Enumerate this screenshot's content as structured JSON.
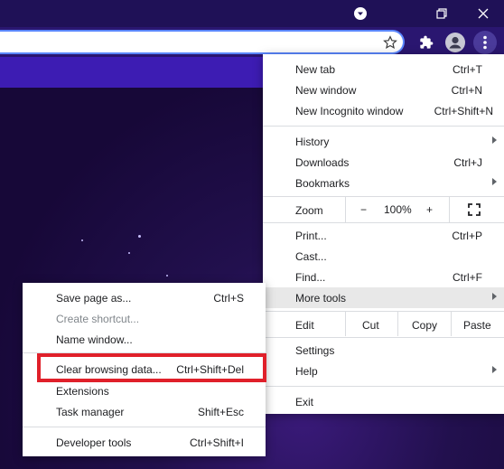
{
  "colors": {
    "highlight_box": "#e0202a",
    "accent": "#5b87ff"
  },
  "titlebar": {
    "icons": [
      "tab-search-icon",
      "restore-icon",
      "close-icon"
    ]
  },
  "toolbar": {
    "icons": [
      "bookmark-star-icon",
      "extensions-icon",
      "profile-icon",
      "menu-kebab-icon"
    ]
  },
  "menu": {
    "new_tab": {
      "label": "New tab",
      "shortcut": "Ctrl+T"
    },
    "new_window": {
      "label": "New window",
      "shortcut": "Ctrl+N"
    },
    "new_incognito": {
      "label": "New Incognito window",
      "shortcut": "Ctrl+Shift+N"
    },
    "history": {
      "label": "History"
    },
    "downloads": {
      "label": "Downloads",
      "shortcut": "Ctrl+J"
    },
    "bookmarks": {
      "label": "Bookmarks"
    },
    "zoom": {
      "label": "Zoom",
      "minus": "−",
      "value": "100%",
      "plus": "+"
    },
    "print": {
      "label": "Print...",
      "shortcut": "Ctrl+P"
    },
    "cast": {
      "label": "Cast..."
    },
    "find": {
      "label": "Find...",
      "shortcut": "Ctrl+F"
    },
    "more_tools": {
      "label": "More tools"
    },
    "edit": {
      "label": "Edit",
      "cut": "Cut",
      "copy": "Copy",
      "paste": "Paste"
    },
    "settings": {
      "label": "Settings"
    },
    "help": {
      "label": "Help"
    },
    "exit": {
      "label": "Exit"
    }
  },
  "submenu": {
    "save_page": {
      "label": "Save page as...",
      "shortcut": "Ctrl+S"
    },
    "create_shortcut": {
      "label": "Create shortcut..."
    },
    "name_window": {
      "label": "Name window..."
    },
    "clear_browsing": {
      "label": "Clear browsing data...",
      "shortcut": "Ctrl+Shift+Del"
    },
    "extensions": {
      "label": "Extensions"
    },
    "task_manager": {
      "label": "Task manager",
      "shortcut": "Shift+Esc"
    },
    "developer_tools": {
      "label": "Developer tools",
      "shortcut": "Ctrl+Shift+I"
    }
  }
}
